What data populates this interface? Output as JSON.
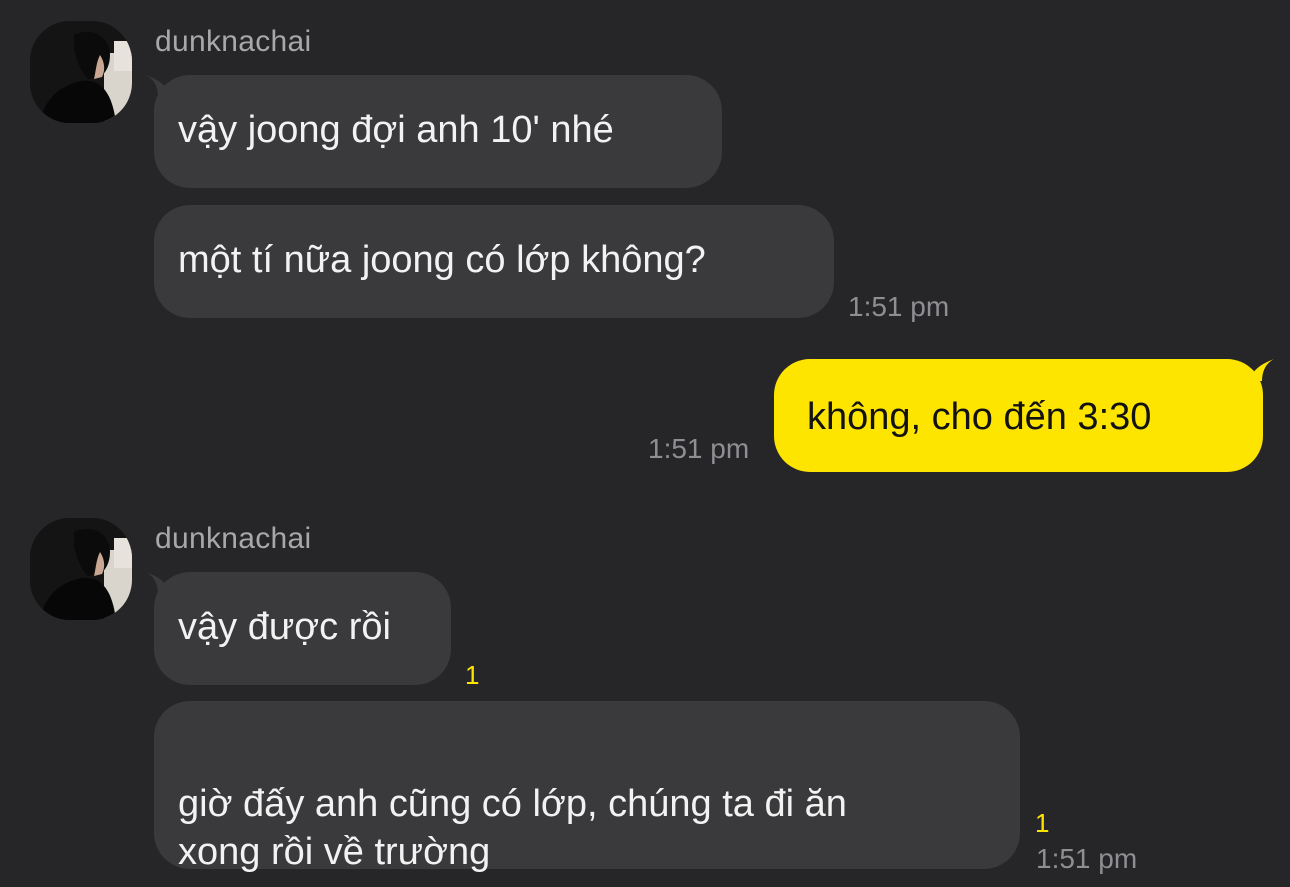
{
  "colors": {
    "background": "#262628",
    "incoming_bubble": "#3a3a3c",
    "outgoing_bubble": "#fee500",
    "unread_counter": "#fee500"
  },
  "groups": [
    {
      "sender": "dunknachai",
      "avatar_icon": "profile-photo-icon"
    },
    {
      "sender": "dunknachai",
      "avatar_icon": "profile-photo-icon"
    }
  ],
  "messages": [
    {
      "direction": "incoming",
      "text": "vậy joong đợi anh 10' nhé",
      "time": "",
      "unread": ""
    },
    {
      "direction": "incoming",
      "text": "một tí nữa joong có lớp không?",
      "time": "1:51 pm",
      "unread": ""
    },
    {
      "direction": "outgoing",
      "text": "không, cho đến 3:30",
      "time": "1:51 pm",
      "unread": ""
    },
    {
      "direction": "incoming",
      "text": "vậy được rồi",
      "time": "",
      "unread": "1"
    },
    {
      "direction": "incoming",
      "text": "giờ đấy anh cũng có lớp, chúng ta đi ăn\nxong rồi về trường",
      "time": "1:51 pm",
      "unread": "1"
    }
  ]
}
